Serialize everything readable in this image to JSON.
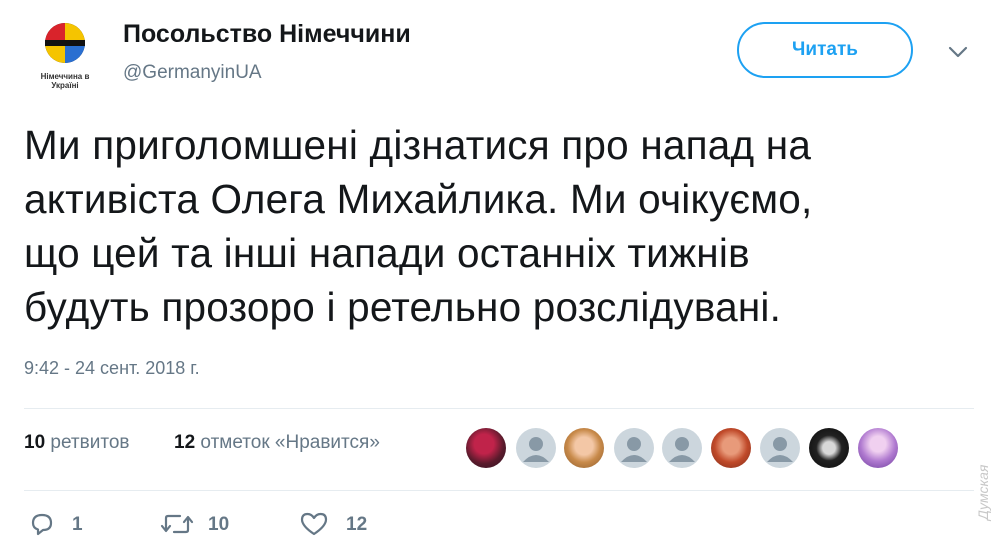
{
  "account": {
    "name": "Посольство Німеччини",
    "handle": "@GermanyinUA",
    "avatar_caption_line1": "Німеччина в",
    "avatar_caption_line2": "Україні",
    "follow_label": "Читать"
  },
  "tweet": {
    "lines": [
      "Ми приголомшені дізнатися про напад на",
      "активіста Олега Михайлика. Ми очікуємо,",
      "що цей та інші напади останніх тижнів",
      "будуть прозоро і ретельно розслідувані."
    ],
    "timestamp": "9:42 - 24 сент. 2018 г."
  },
  "stats": {
    "retweets_count": "10",
    "retweets_label": "ретвитов",
    "likes_count": "12",
    "likes_label": "отметок «Нравится»"
  },
  "actions": {
    "reply_count": "1",
    "retweet_count": "10",
    "like_count": "12"
  },
  "watermark": "Думская",
  "colors": {
    "accent": "#1da1f2",
    "secondary_text": "#657786",
    "divider": "#e6ecf0"
  }
}
